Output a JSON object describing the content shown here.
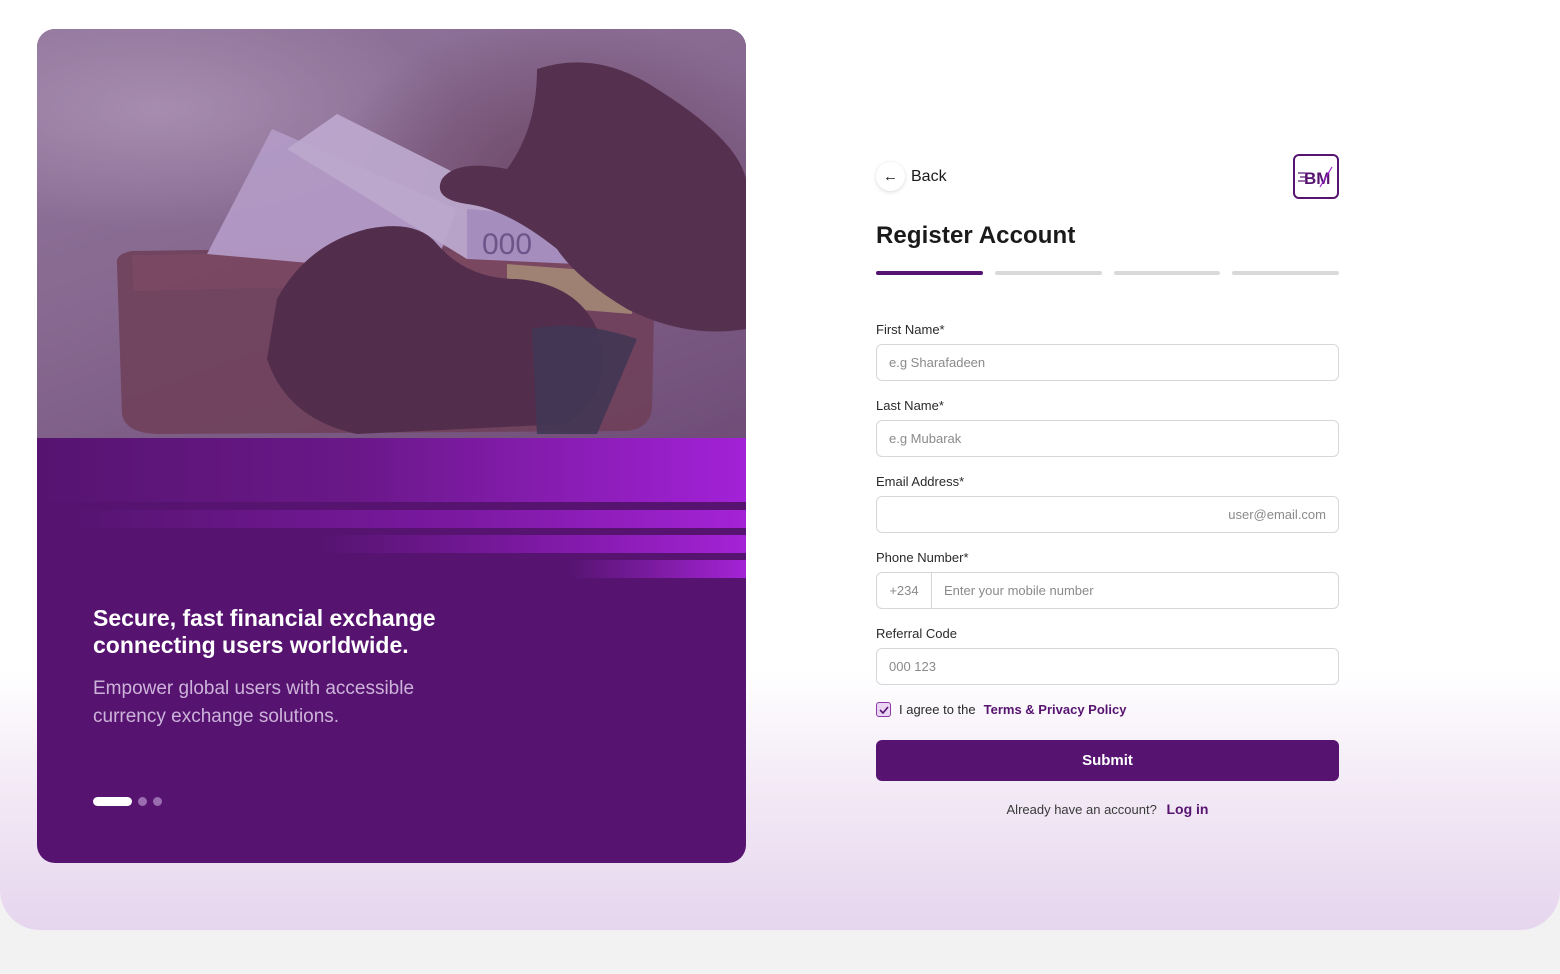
{
  "hero": {
    "headline": "Secure, fast financial exchange connecting users worldwide.",
    "subtext": "Empower global users with accessible currency exchange solutions.",
    "carousel": {
      "total": 3,
      "active": 1
    }
  },
  "header": {
    "back_label": "Back",
    "logo_text": "BM",
    "title": "Register Account",
    "progress": {
      "steps": 4,
      "current": 1
    }
  },
  "form": {
    "first_name": {
      "label": "First Name*",
      "placeholder": "e.g Sharafadeen"
    },
    "last_name": {
      "label": "Last Name*",
      "placeholder": "e.g Mubarak"
    },
    "email": {
      "label": "Email Address*",
      "placeholder": "user@email.com"
    },
    "phone": {
      "label": "Phone Number*",
      "prefix": "+234",
      "placeholder": "Enter your mobile number"
    },
    "referral": {
      "label": "Referral Code",
      "placeholder": "000 123"
    },
    "agree_text": "I agree to the",
    "terms_link": "Terms & Privacy Policy",
    "agree_checked": true,
    "submit_label": "Submit"
  },
  "footer": {
    "login_prompt": "Already have an account?",
    "login_link": "Log in"
  },
  "colors": {
    "brand": "#561470",
    "accent_stripe": "#a321d8"
  }
}
